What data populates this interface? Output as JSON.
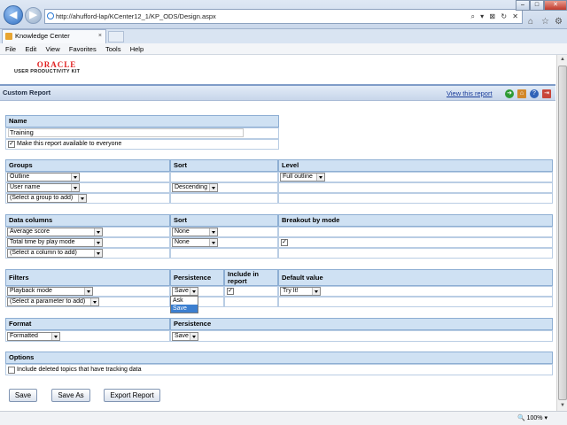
{
  "browser": {
    "url": "http://ahufford-lap/KCenter12_1/KP_ODS/Design.aspx",
    "url_tools": [
      "⌕",
      "▾",
      "⊠",
      "↻",
      "✕"
    ],
    "tab_title": "Knowledge Center",
    "tab_close": "×",
    "menu": [
      "File",
      "Edit",
      "View",
      "Favorites",
      "Tools",
      "Help"
    ],
    "zoom": "100%"
  },
  "header": {
    "logo_top": "ORACLE",
    "logo_bottom": "USER PRODUCTIVITY KIT",
    "title": "Custom Report",
    "view_link": "View this report"
  },
  "name_section": {
    "header": "Name",
    "value": "Training",
    "available_label": "Make this report available to everyone"
  },
  "groups_section": {
    "headers": [
      "Groups",
      "Sort",
      "Level"
    ],
    "rows": [
      {
        "group": "Outline",
        "sort": "",
        "level": "Full outline"
      },
      {
        "group": "User name",
        "sort": "Descending",
        "level": ""
      },
      {
        "group": "(Select a group to add)",
        "sort": "",
        "level": ""
      }
    ]
  },
  "columns_section": {
    "headers": [
      "Data columns",
      "Sort",
      "Breakout by mode"
    ],
    "rows": [
      {
        "column": "Average score",
        "sort": "None"
      },
      {
        "column": "Total time by play mode",
        "sort": "None"
      },
      {
        "column": "(Select a column to add)",
        "sort": ""
      }
    ]
  },
  "filters_section": {
    "headers": [
      "Filters",
      "Persistence",
      "Include in report",
      "Default value"
    ],
    "rows": [
      {
        "filter": "Playback mode",
        "persistence": "Save",
        "default": "Try It!"
      },
      {
        "filter": "(Select a parameter to add)",
        "persistence": "",
        "default": ""
      }
    ],
    "dropdown_options": [
      "Ask",
      "Save"
    ]
  },
  "format_section": {
    "headers": [
      "Format",
      "Persistence"
    ],
    "format": "Formatted",
    "persistence": "Save"
  },
  "options_section": {
    "header": "Options",
    "include_deleted_label": "Include deleted topics that have tracking data"
  },
  "buttons": {
    "save": "Save",
    "save_as": "Save As",
    "export": "Export Report"
  }
}
